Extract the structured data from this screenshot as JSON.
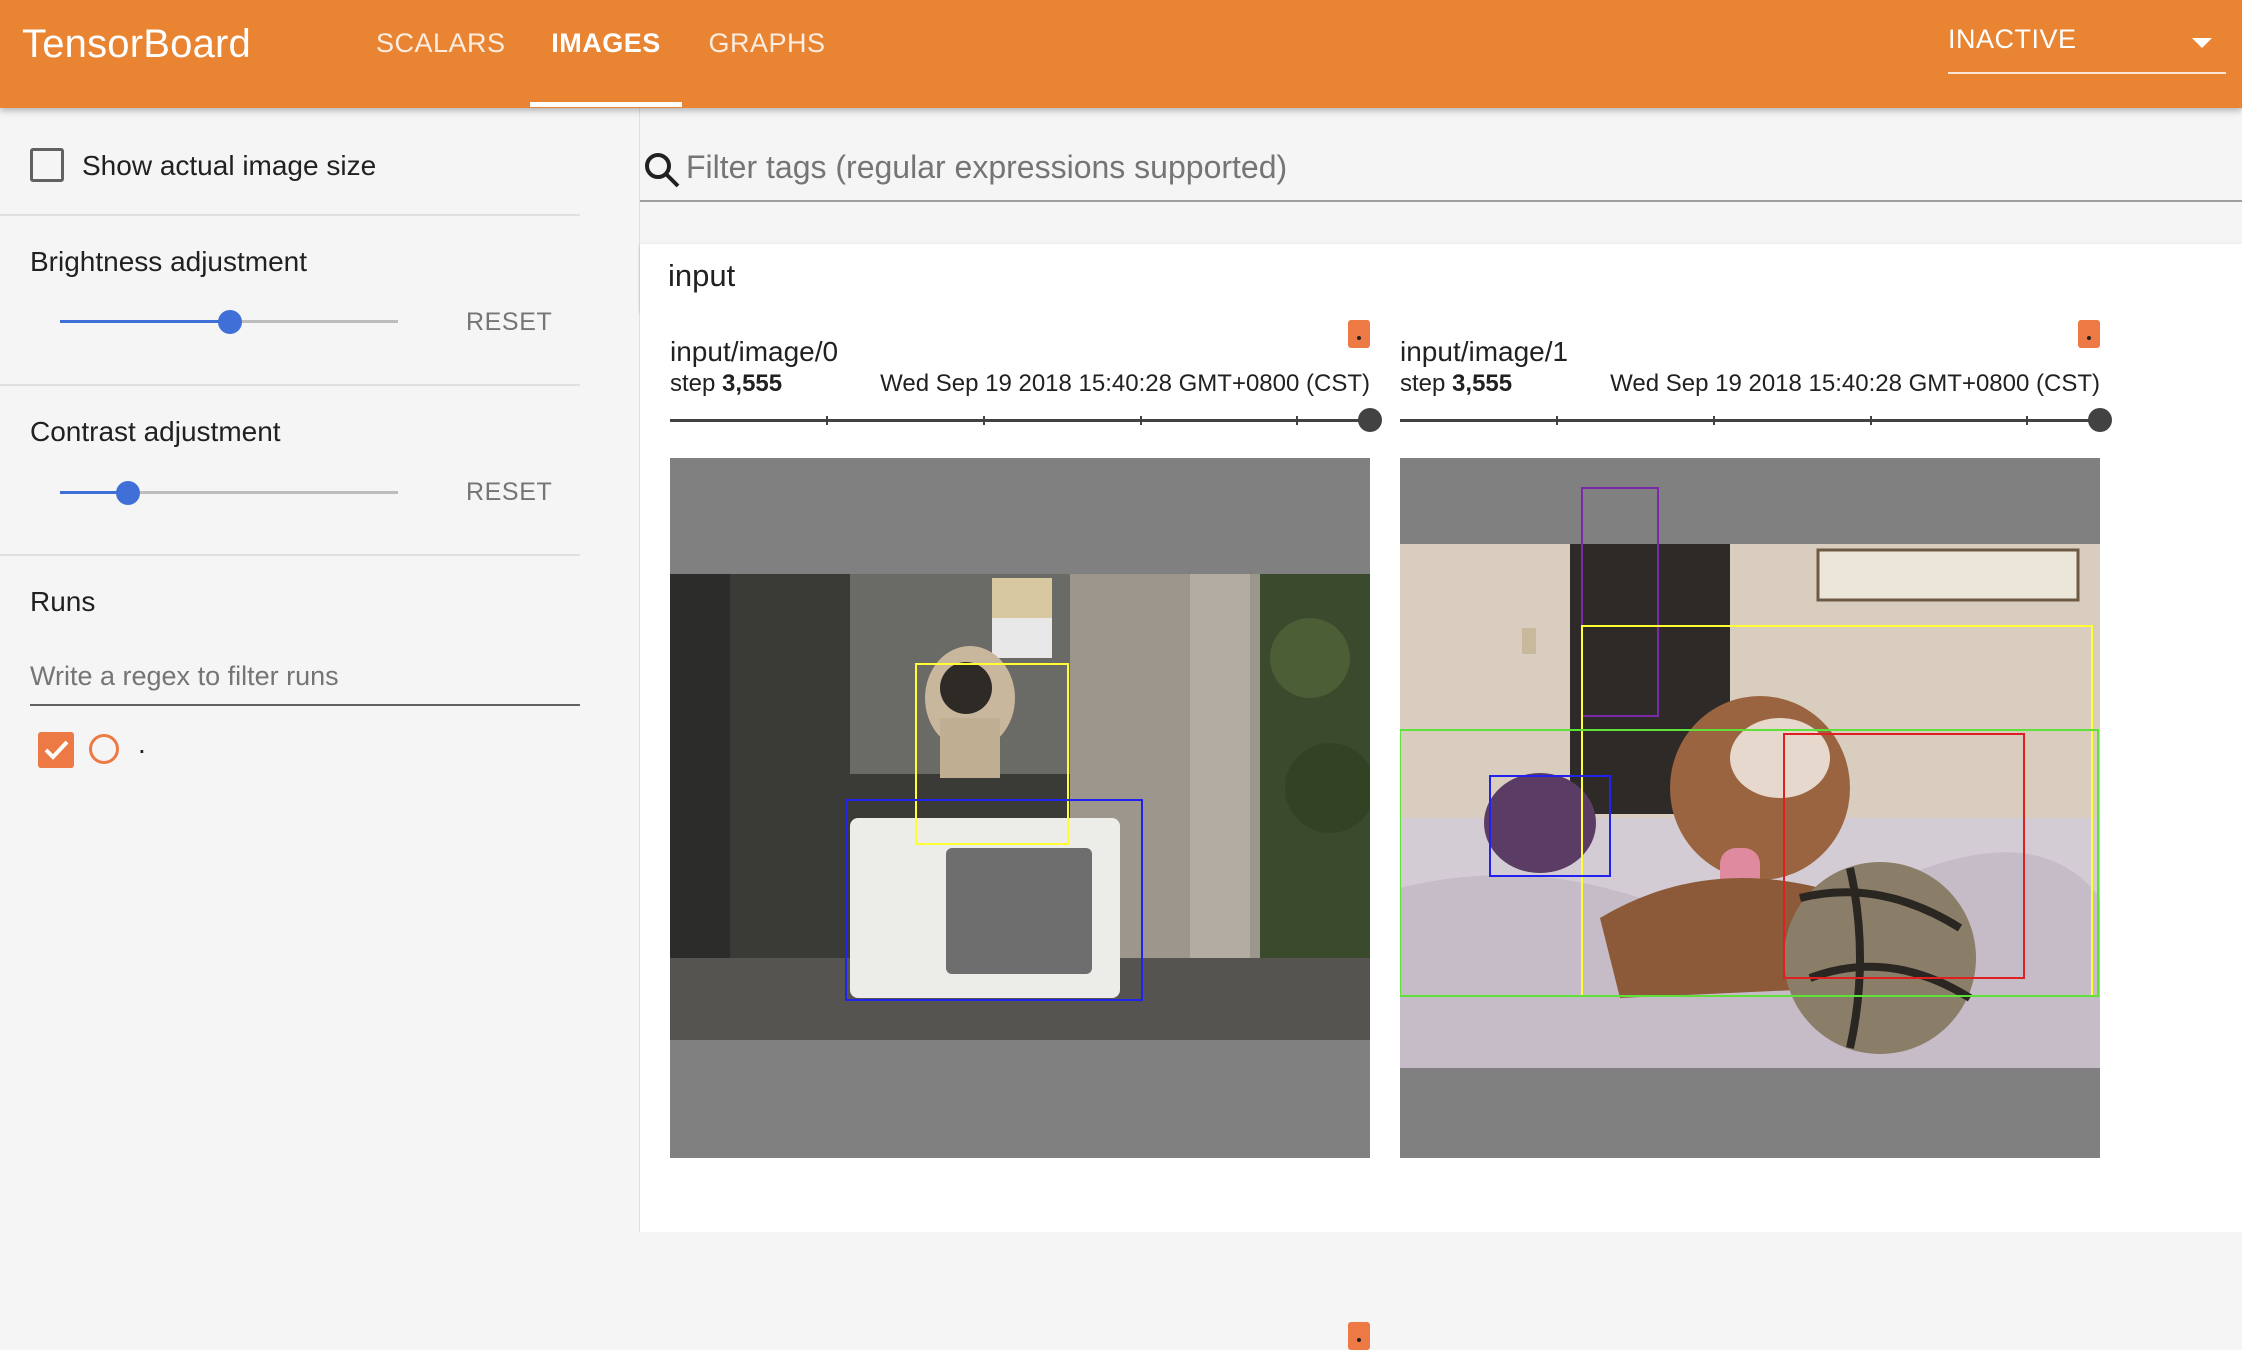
{
  "app": {
    "title": "TensorBoard",
    "accent_color": "#e88432"
  },
  "tabs": [
    {
      "label": "SCALARS",
      "active": false
    },
    {
      "label": "IMAGES",
      "active": true
    },
    {
      "label": "GRAPHS",
      "active": false
    }
  ],
  "run_selector": {
    "value": "INACTIVE"
  },
  "sidebar": {
    "show_actual_size": {
      "label": "Show actual image size",
      "checked": false
    },
    "brightness": {
      "label": "Brightness adjustment",
      "value": 0.5,
      "reset": "RESET"
    },
    "contrast": {
      "label": "Contrast adjustment",
      "value": 0.2,
      "reset": "RESET"
    },
    "runs": {
      "title": "Runs",
      "filter_placeholder": "Write a regex to filter runs",
      "items": [
        {
          "name": ".",
          "checked": true,
          "color": "#ed7a45"
        }
      ]
    }
  },
  "main": {
    "search_placeholder": "Filter tags (regular expressions supported)",
    "category": "input",
    "cards": [
      {
        "tag": "input/image/0",
        "step_label": "step",
        "step": "3,555",
        "time": "Wed Sep 19 2018 15:40:28 GMT+0800 (CST)"
      },
      {
        "tag": "input/image/1",
        "step_label": "step",
        "step": "3,555",
        "time": "Wed Sep 19 2018 15:40:28 GMT+0800 (CST)"
      }
    ]
  },
  "icons": [
    "search-icon",
    "dropdown-caret-icon",
    "checkbox-icon",
    "radio-icon",
    "run-color-icon"
  ]
}
